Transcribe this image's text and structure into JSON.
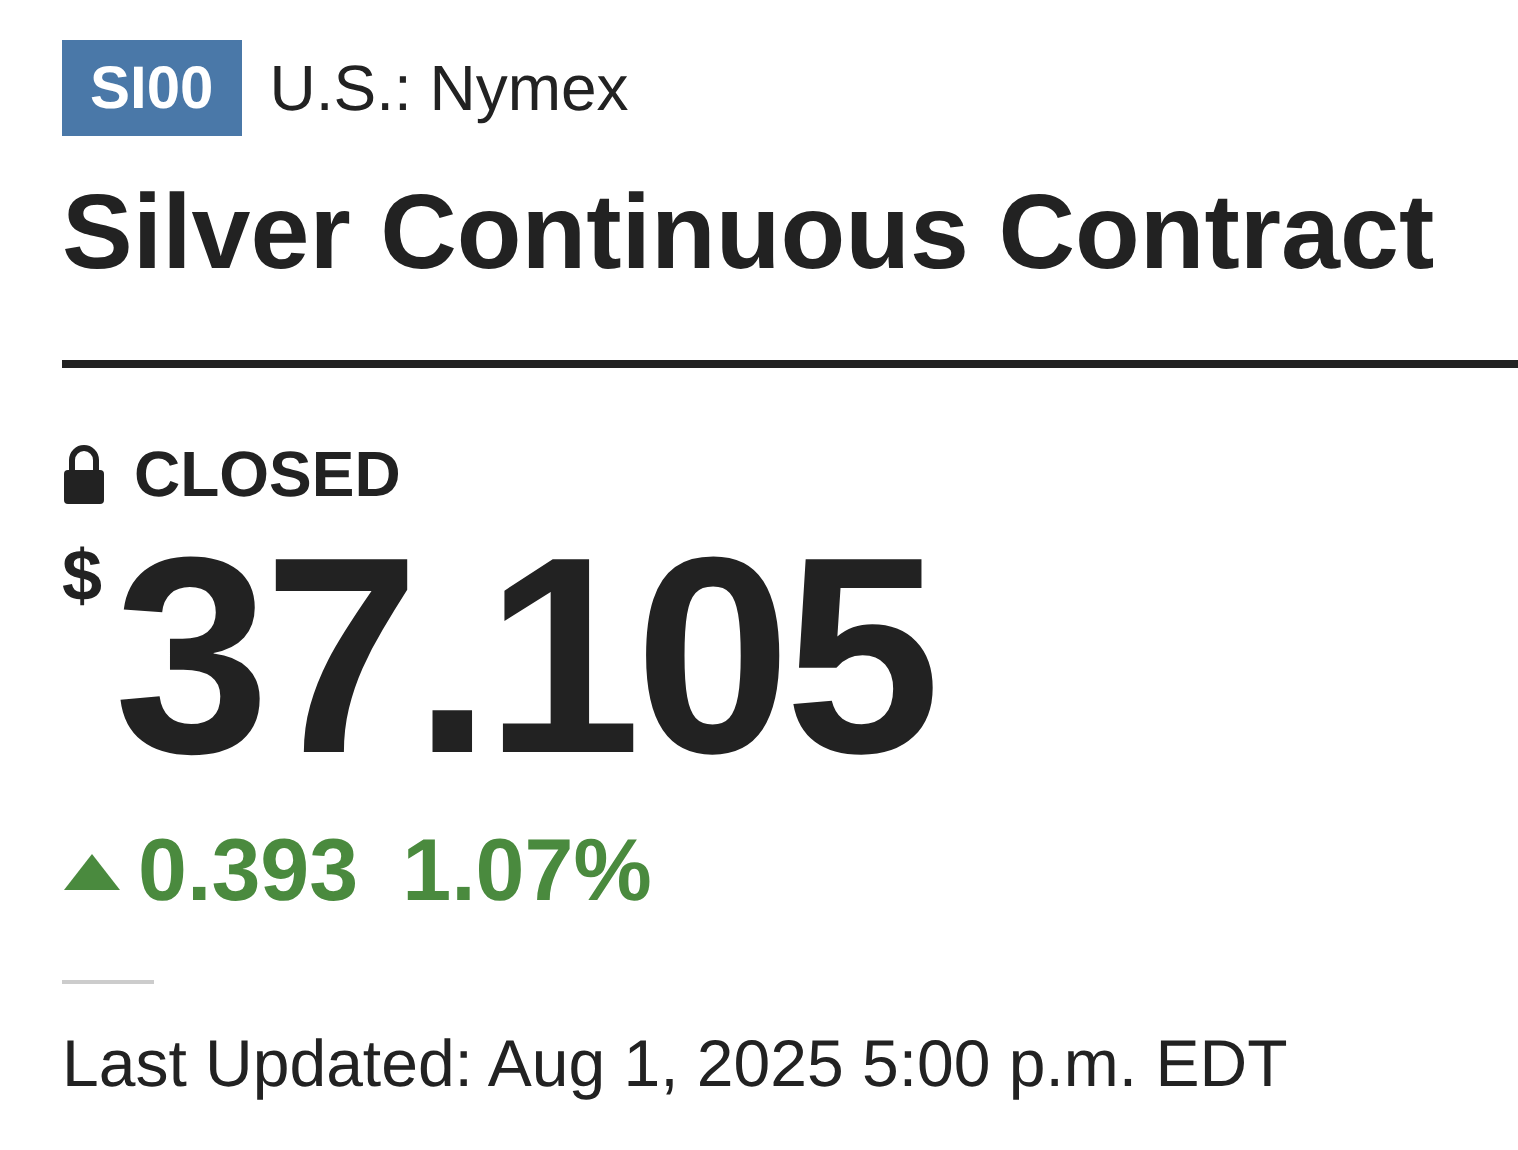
{
  "ticker": "SI00",
  "exchange": "U.S.: Nymex",
  "title": "Silver Continuous Contract",
  "market_status": {
    "kind": "closed",
    "label": "CLOSED"
  },
  "price": {
    "currency": "$",
    "value": "37.105"
  },
  "change": {
    "rising": true,
    "points": "0.393",
    "percent": "1.07%"
  },
  "last_updated": "Last Updated: Aug 1, 2025 5:00 p.m. EDT"
}
